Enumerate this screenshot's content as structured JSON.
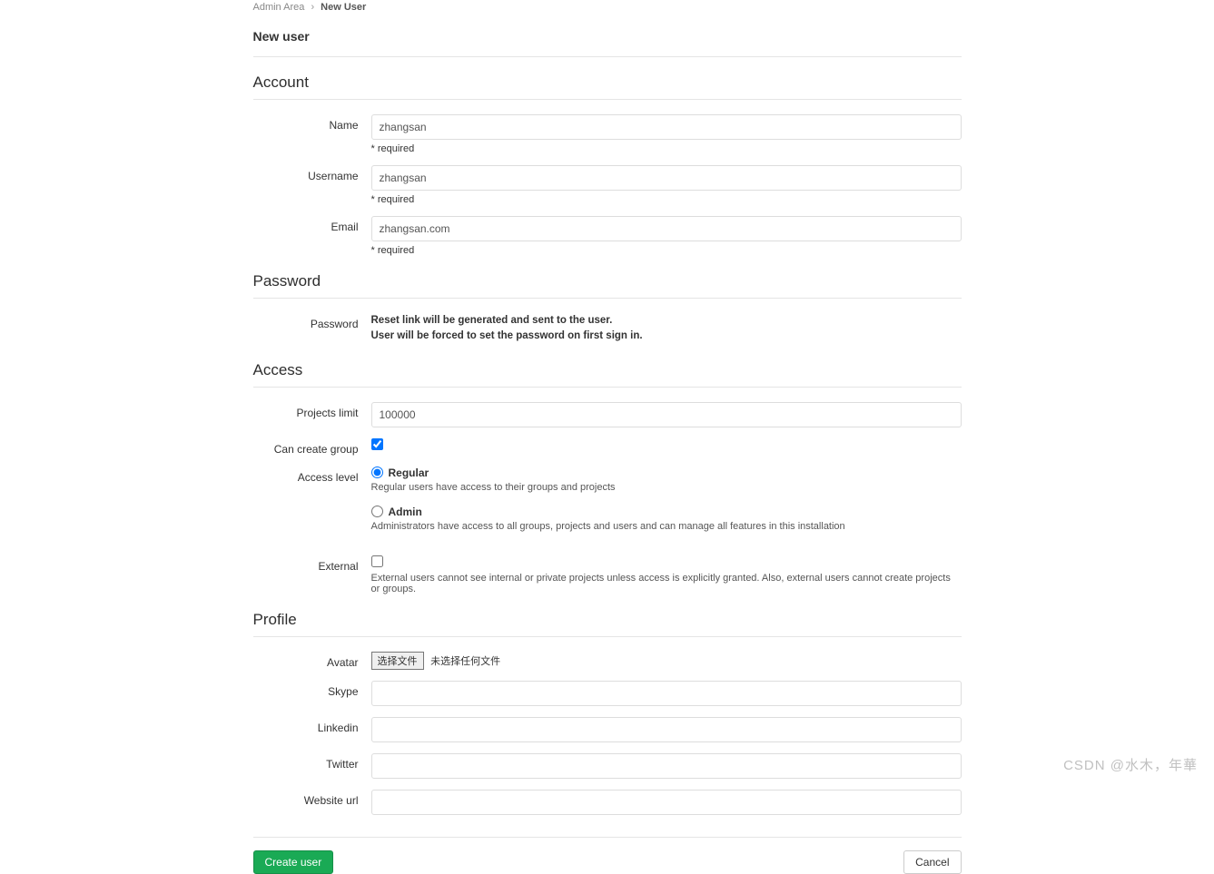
{
  "breadcrumb": {
    "root": "Admin Area",
    "current": "New User"
  },
  "page_title": "New user",
  "account": {
    "heading": "Account",
    "name": {
      "label": "Name",
      "value": "zhangsan",
      "required": "* required"
    },
    "username": {
      "label": "Username",
      "value": "zhangsan",
      "required": "* required"
    },
    "email": {
      "label": "Email",
      "value": "zhangsan.com",
      "required": "* required"
    }
  },
  "password": {
    "heading": "Password",
    "label": "Password",
    "line1": "Reset link will be generated and sent to the user.",
    "line2": "User will be forced to set the password on first sign in."
  },
  "access": {
    "heading": "Access",
    "projects_limit": {
      "label": "Projects limit",
      "value": "100000"
    },
    "can_create_group": {
      "label": "Can create group",
      "checked": true
    },
    "access_level": {
      "label": "Access level",
      "regular": {
        "label": "Regular",
        "help": "Regular users have access to their groups and projects",
        "selected": true
      },
      "admin": {
        "label": "Admin",
        "help": "Administrators have access to all groups, projects and users and can manage all features in this installation",
        "selected": false
      }
    },
    "external": {
      "label": "External",
      "checked": false,
      "help": "External users cannot see internal or private projects unless access is explicitly granted. Also, external users cannot create projects or groups."
    }
  },
  "profile": {
    "heading": "Profile",
    "avatar": {
      "label": "Avatar",
      "button": "选择文件",
      "status": "未选择任何文件"
    },
    "skype": {
      "label": "Skype",
      "value": ""
    },
    "linkedin": {
      "label": "Linkedin",
      "value": ""
    },
    "twitter": {
      "label": "Twitter",
      "value": ""
    },
    "website": {
      "label": "Website url",
      "value": ""
    }
  },
  "actions": {
    "submit": "Create user",
    "cancel": "Cancel"
  },
  "watermark": "CSDN @水木，年華"
}
